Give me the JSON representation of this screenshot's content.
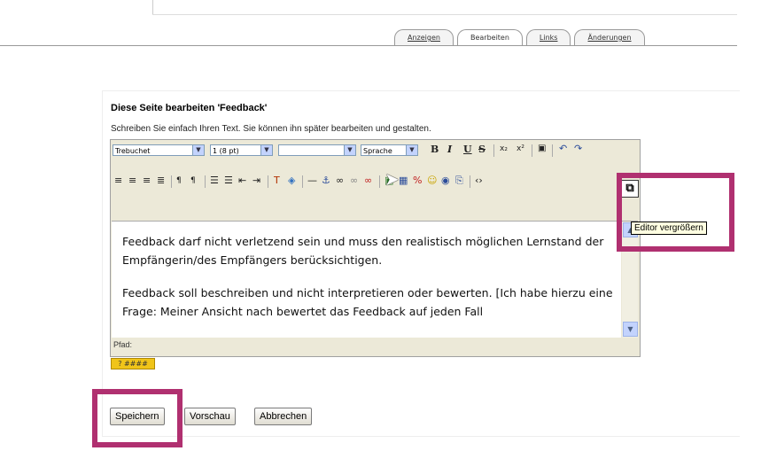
{
  "tabs": [
    {
      "label": "Anzeigen",
      "link": true
    },
    {
      "label": "Bearbeiten",
      "link": false
    },
    {
      "label": "Links",
      "link": true
    },
    {
      "label": "Änderungen",
      "link": true
    }
  ],
  "page": {
    "heading": "Diese Seite bearbeiten 'Feedback'",
    "intro": "Schreiben Sie einfach Ihren Text. Sie können ihn später bearbeiten und gestalten."
  },
  "editor": {
    "font_select": "Trebuchet",
    "size_select": "1 (8 pt)",
    "format_select": "",
    "language_select": "Sprache",
    "bold": "B",
    "italic": "I",
    "underline": "U",
    "strike": "S",
    "paragraph1": "Feedback darf nicht verletzend sein und muss den realistisch möglichen Lernstand der Empfängerin/des Empfängers berücksichtigen.",
    "paragraph2": "Feedback soll beschreiben und nicht interpretieren oder bewerten. [Ich habe hierzu eine Frage: Meiner Ansicht nach bewertet das Feedback auf jeden Fall",
    "path_label": "Pfad:",
    "tooltip": "Editor vergrößern"
  },
  "buttons": {
    "save": "Speichern",
    "preview": "Vorschau",
    "cancel": "Abbrechen"
  },
  "colors": {
    "highlight": "#b03070",
    "toolbar_bg": "#ece9d8"
  }
}
